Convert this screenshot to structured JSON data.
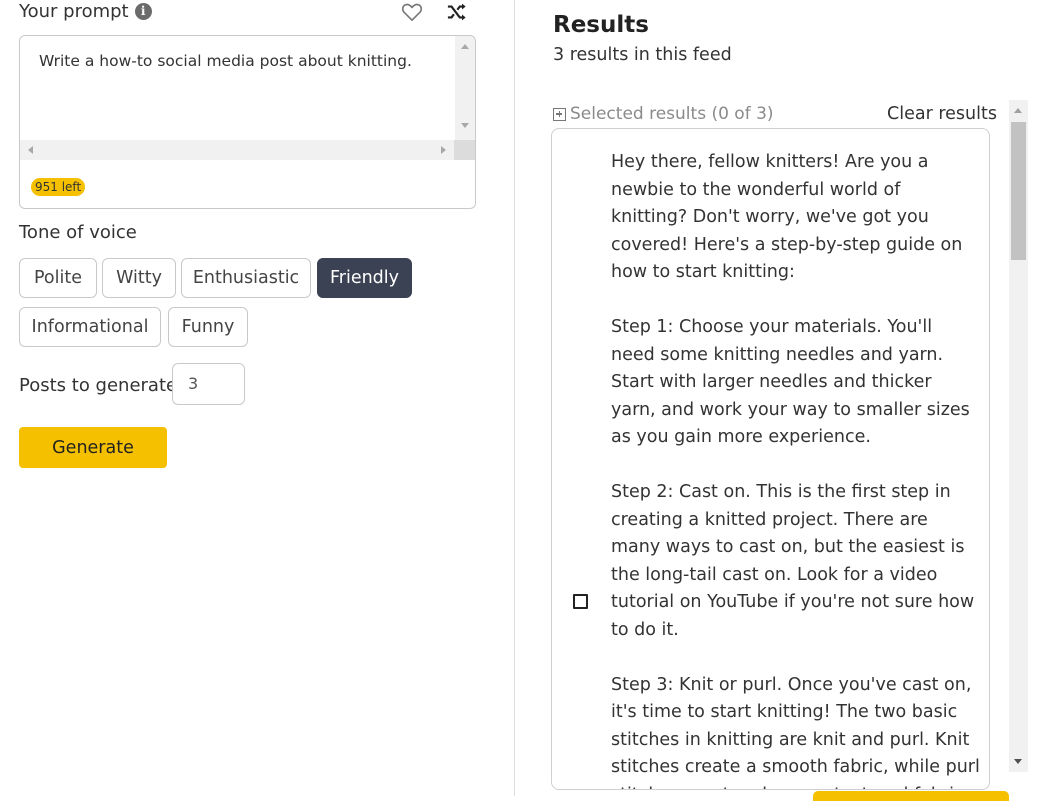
{
  "prompt": {
    "label": "Your prompt",
    "value": "Write a how-to social media post about knitting.",
    "remaining": "951 left"
  },
  "tone": {
    "label": "Tone of voice",
    "options": [
      "Polite",
      "Witty",
      "Enthusiastic",
      "Friendly",
      "Informational",
      "Funny"
    ],
    "selected": "Friendly"
  },
  "posts": {
    "label": "Posts to generate",
    "value": "3"
  },
  "generate_label": "Generate",
  "results": {
    "title": "Results",
    "subtitle": "3 results in this feed",
    "selected_label": "Selected results (0 of 3)",
    "clear_label": "Clear results",
    "items": [
      {
        "text": "Hey there, fellow knitters! Are you a newbie to the wonderful world of knitting? Don't worry, we've got you covered! Here's a step-by-step guide on how to start knitting:\n\nStep 1: Choose your materials. You'll need some knitting needles and yarn. Start with larger needles and thicker yarn, and work your way to smaller sizes as you gain more experience.\n\nStep 2: Cast on. This is the first step in creating a knitted project. There are many ways to cast on, but the easiest is the long-tail cast on. Look for a video tutorial on YouTube if you're not sure how to do it.\n\nStep 3: Knit or purl. Once you've cast on, it's time to start knitting! The two basic stitches in knitting are knit and purl. Knit stitches create a smooth fabric, while purl stitches create a bumpy, textured fabric."
      }
    ]
  },
  "colors": {
    "accent": "#f5c000",
    "active_chip": "#3b4253"
  },
  "icons": [
    "info-icon",
    "heart-icon",
    "shuffle-icon",
    "plus-box-icon"
  ]
}
